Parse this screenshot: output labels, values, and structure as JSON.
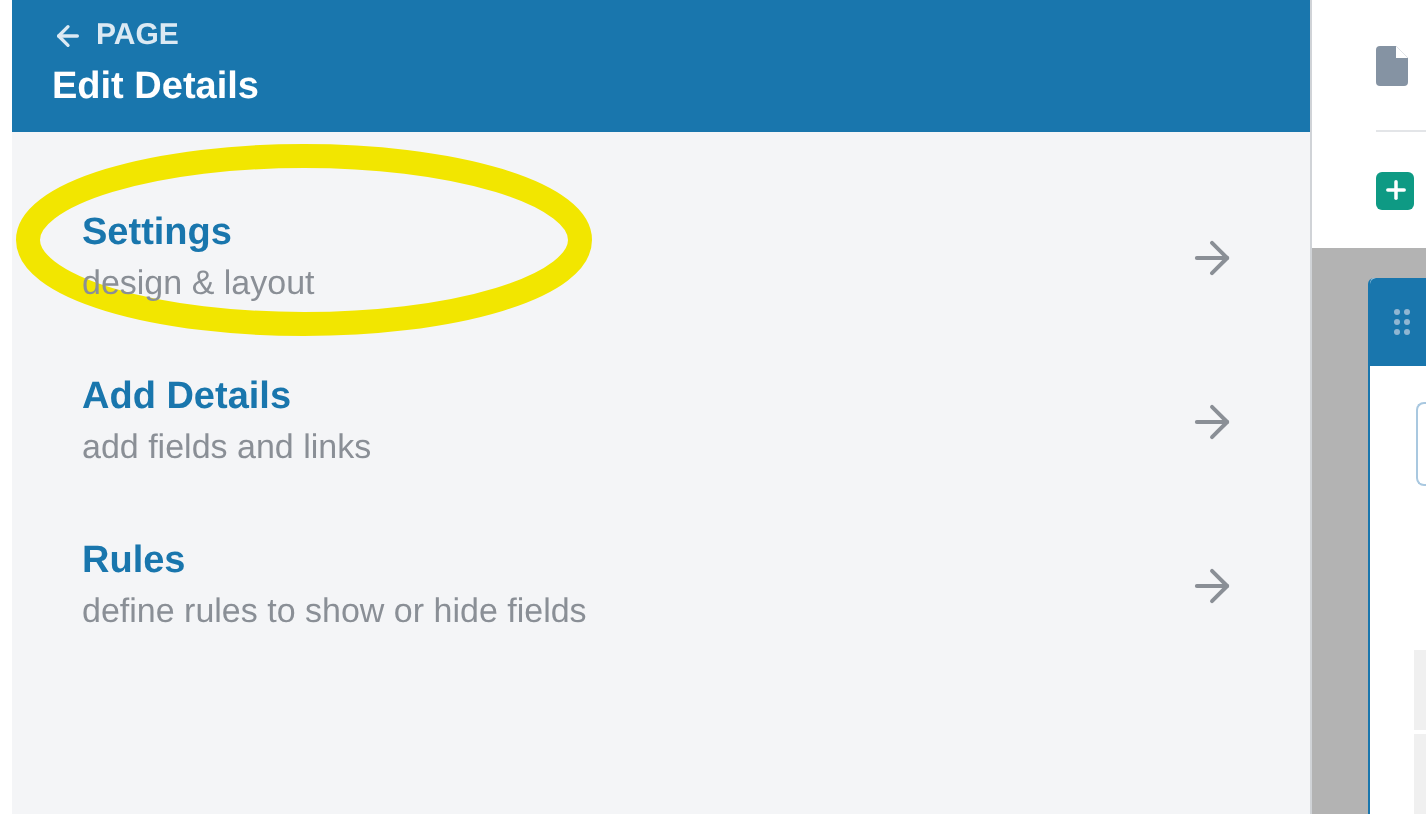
{
  "header": {
    "back_label": "PAGE",
    "title": "Edit Details"
  },
  "items": [
    {
      "title": "Settings",
      "subtitle": "design & layout",
      "highlighted": true
    },
    {
      "title": "Add Details",
      "subtitle": "add fields and links",
      "highlighted": false
    },
    {
      "title": "Rules",
      "subtitle": "define rules to show or hide fields",
      "highlighted": false
    }
  ]
}
